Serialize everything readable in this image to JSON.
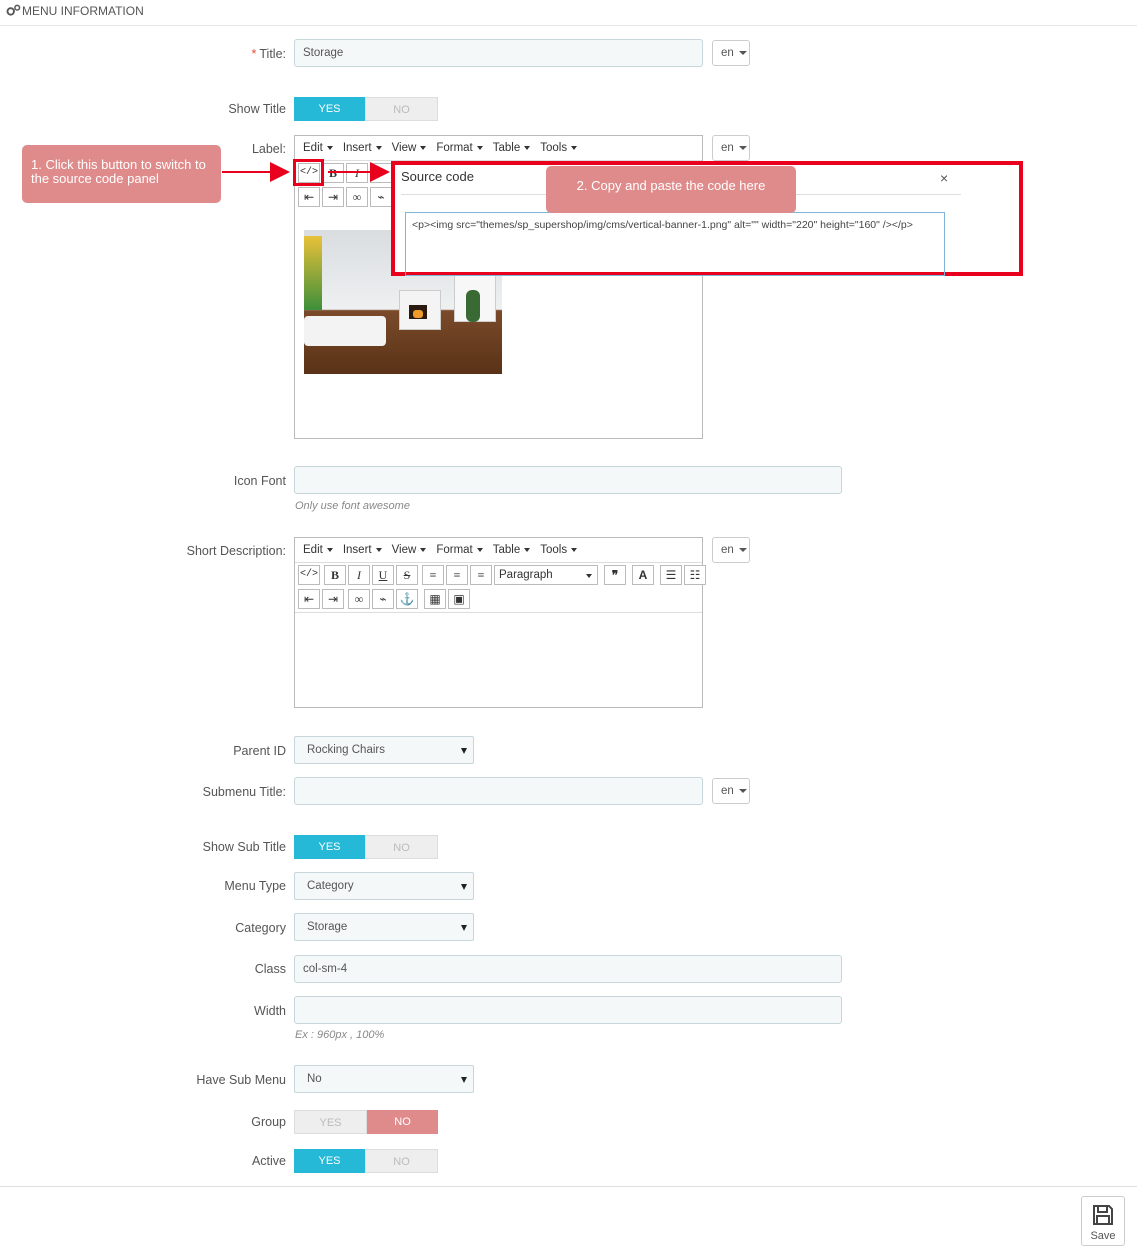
{
  "header": {
    "title": "MENU INFORMATION"
  },
  "fields": {
    "title": {
      "label": "Title:",
      "required_mark": "*",
      "value": "Storage",
      "lang": "en"
    },
    "show_title": {
      "label": "Show Title",
      "yes": "YES",
      "no": "NO"
    },
    "label": {
      "label": "Label:",
      "lang": "en"
    },
    "icon_font": {
      "label": "Icon Font",
      "value": "",
      "help": "Only use font awesome"
    },
    "short_description": {
      "label": "Short Description:",
      "lang": "en"
    },
    "parent_id": {
      "label": "Parent ID",
      "value": "Rocking Chairs"
    },
    "submenu_title": {
      "label": "Submenu Title:",
      "value": "",
      "lang": "en"
    },
    "show_sub_title": {
      "label": "Show Sub Title",
      "yes": "YES",
      "no": "NO"
    },
    "menu_type": {
      "label": "Menu Type",
      "value": "Category"
    },
    "category": {
      "label": "Category",
      "value": "Storage"
    },
    "class": {
      "label": "Class",
      "value": "col-sm-4"
    },
    "width": {
      "label": "Width",
      "value": "",
      "help": "Ex : 960px , 100%"
    },
    "have_sub_menu": {
      "label": "Have Sub Menu",
      "value": "No"
    },
    "group": {
      "label": "Group",
      "yes": "YES",
      "no": "NO"
    },
    "active": {
      "label": "Active",
      "yes": "YES",
      "no": "NO"
    }
  },
  "editor": {
    "menu": [
      "Edit",
      "Insert",
      "View",
      "Format",
      "Table",
      "Tools"
    ],
    "format_select": "Paragraph"
  },
  "source_dialog": {
    "title": "Source code",
    "close": "×",
    "code": "<p><img src=\"themes/sp_supershop/img/cms/vertical-banner-1.png\" alt=\"\" width=\"220\" height=\"160\" /></p>"
  },
  "callouts": {
    "step1": "1. Click this button to switch to the source code panel",
    "step2": "2. Copy and paste the code here"
  },
  "footer": {
    "save": "Save"
  },
  "colors": {
    "accent": "#25b9d7",
    "callout": "#e08b8b",
    "highlight": "#e8001c"
  }
}
